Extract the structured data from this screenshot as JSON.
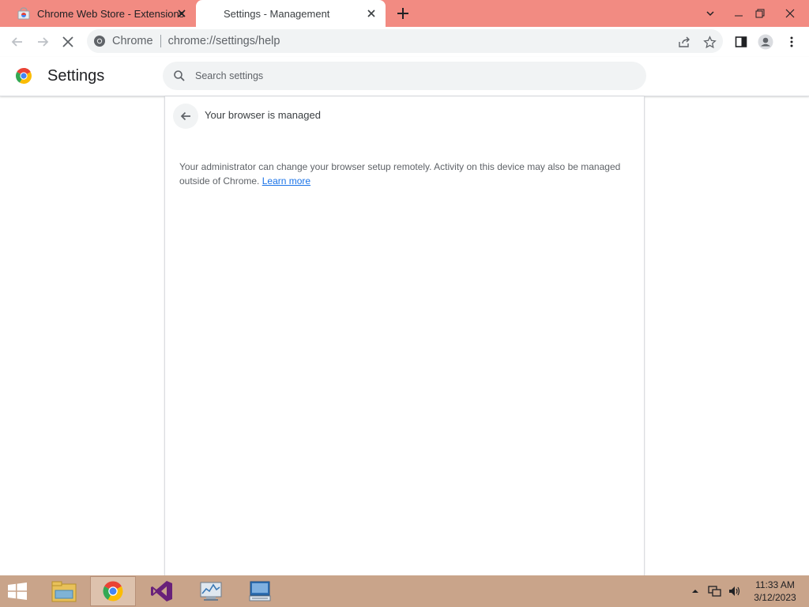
{
  "tabs": [
    {
      "title": "Chrome Web Store - Extensions",
      "favicon": "webstore-icon",
      "active": false
    },
    {
      "title": "Settings - Management",
      "favicon": "",
      "active": true
    }
  ],
  "window_controls": [
    "chevron-down-icon",
    "minimize-icon",
    "restore-icon",
    "close-icon"
  ],
  "toolbar": {
    "site_chip": "Chrome",
    "url": "chrome://settings/help",
    "icons": [
      "back-icon",
      "forward-icon",
      "stop-loading-icon",
      "share-icon",
      "star-icon",
      "side-panel-icon",
      "profile-icon",
      "menu-icon"
    ]
  },
  "settings": {
    "title": "Settings",
    "search_placeholder": "Search settings"
  },
  "management": {
    "heading": "Your browser is managed",
    "text_line": "Your administrator can change your browser setup remotely. Activity on this device may also be managed outside of Chrome.",
    "learn_more": "Learn more"
  },
  "taskbar": {
    "items": [
      "file-explorer-icon",
      "chrome-icon",
      "visual-studio-icon",
      "task-manager-icon",
      "remote-desktop-icon"
    ],
    "time": "11:33 AM",
    "date": "3/12/2023"
  },
  "colors": {
    "tabstrip": "#f28b82",
    "accent": "#1a73e8",
    "taskbar": "#c9a48a"
  }
}
